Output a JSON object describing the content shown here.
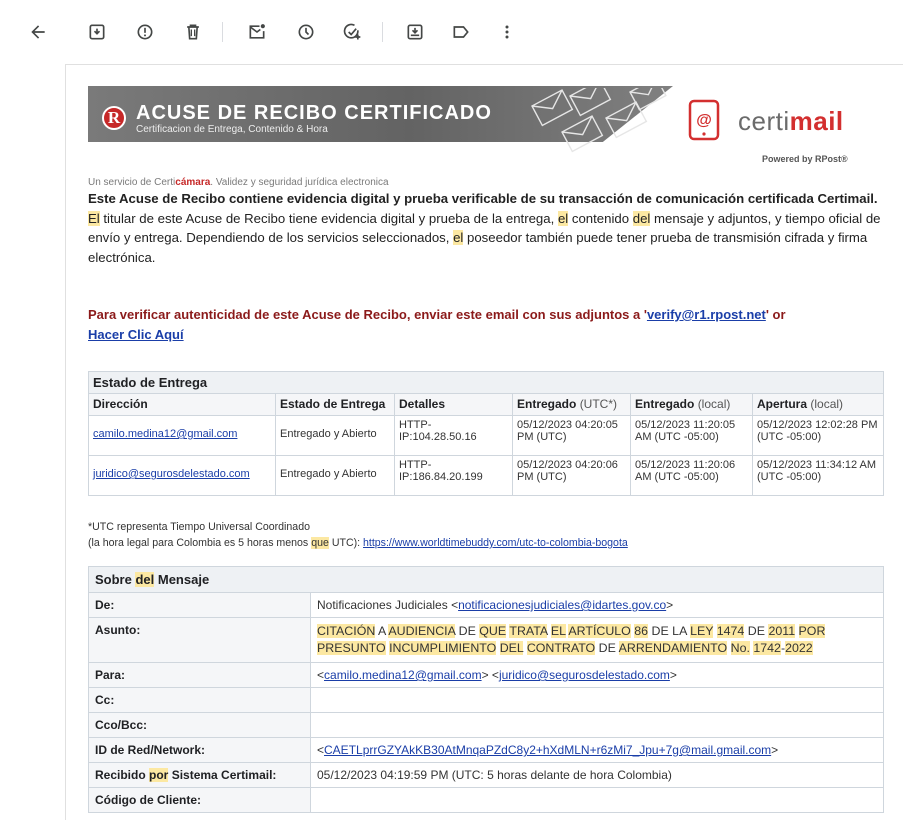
{
  "toolbar": {
    "back_icon": "arrow-left-icon",
    "icons": [
      "archive-icon",
      "report-spam-icon",
      "delete-icon",
      "mark-unread-icon",
      "snooze-icon",
      "add-task-icon",
      "move-to-icon",
      "label-icon",
      "more-vert-icon"
    ]
  },
  "banner": {
    "r_letter": "R",
    "title": "ACUSE DE RECIBO CERTIFICADO",
    "subtitle": "Certificacion de Entrega, Contenido & Hora",
    "service_prefix": "Un servicio de Certi",
    "service_brand": "cámara",
    "service_suffix": ". Validez y seguridad jurídica electronica",
    "logo_certi": "certi",
    "logo_mail": "mail",
    "powered": "Powered by RPost®"
  },
  "intro": {
    "heading": "Este Acuse de Recibo contiene evidencia digital y prueba verificable de su transacción de comunicación certificada Certimail.",
    "p_el1": "El",
    "p_part1": " titular de este Acuse de Recibo tiene evidencia digital y prueba de la entrega, ",
    "p_el2": "el",
    "p_part2": " contenido ",
    "p_del": "del",
    "p_part3": " mensaje y adjuntos, y tiempo oficial de envío y entrega. Dependiendo de los servicios seleccionados, ",
    "p_el3": "el",
    "p_part4": " poseedor también puede tener prueba de transmisión cifrada y firma electrónica."
  },
  "verify": {
    "prefix": "Para verificar autenticidad de este Acuse de Recibo, enviar este email con sus adjuntos a '",
    "email": "verify@r1.rpost.net",
    "mid": "' or",
    "click": "Hacer Clic Aquí"
  },
  "delivery": {
    "title": "Estado de Entrega",
    "headers": {
      "direccion": "Dirección",
      "estado": "Estado de Entrega",
      "detalles": "Detalles",
      "entregado_utc": "Entregado",
      "entregado_utc_tag": "(UTC*)",
      "entregado_local": "Entregado",
      "entregado_local_tag": "(local)",
      "apertura": "Apertura",
      "apertura_tag": "(local)"
    },
    "rows": [
      {
        "address": "camilo.medina12@gmail.com",
        "status": "Entregado y Abierto",
        "details": "HTTP-IP:104.28.50.16",
        "utc": "05/12/2023 04:20:05 PM (UTC)",
        "local": "05/12/2023 11:20:05 AM (UTC -05:00)",
        "opened": "05/12/2023 12:02:28 PM (UTC -05:00)"
      },
      {
        "address": "juridico@segurosdelestado.com",
        "status": "Entregado y Abierto",
        "details": "HTTP-IP:186.84.20.199",
        "utc": "05/12/2023 04:20:06 PM (UTC)",
        "local": "05/12/2023 11:20:06 AM (UTC -05:00)",
        "opened": "05/12/2023 11:34:12 AM (UTC -05:00)"
      }
    ]
  },
  "note": {
    "line1": "*UTC representa Tiempo Universal Coordinado",
    "line2_prefix": "(la hora legal para Colombia es 5 horas menos ",
    "line2_que": "que",
    "line2_mid": " UTC): ",
    "link": "https://www.worldtimebuddy.com/utc-to-colombia-bogota"
  },
  "message": {
    "title_prefix": "Sobre ",
    "title_del": "del",
    "title_suffix": " Mensaje",
    "de_label": "De:",
    "de_name": "Notificaciones Judiciales <",
    "de_email": "notificacionesjudiciales@idartes.gov.co",
    "de_close": ">",
    "asunto_label": "Asunto:",
    "asunto_words": [
      {
        "t": "CITACIÓN",
        "h": true
      },
      {
        "t": " A ",
        "h": false
      },
      {
        "t": "AUDIENCIA",
        "h": true
      },
      {
        "t": " DE ",
        "h": false
      },
      {
        "t": "QUE",
        "h": true
      },
      {
        "t": " ",
        "h": false
      },
      {
        "t": "TRATA",
        "h": true
      },
      {
        "t": " ",
        "h": false
      },
      {
        "t": "EL",
        "h": true
      },
      {
        "t": " ",
        "h": false
      },
      {
        "t": "ARTÍCULO",
        "h": true
      },
      {
        "t": " ",
        "h": false
      },
      {
        "t": "86",
        "h": true
      },
      {
        "t": " DE LA ",
        "h": false
      },
      {
        "t": "LEY",
        "h": true
      },
      {
        "t": " ",
        "h": false
      },
      {
        "t": "1474",
        "h": true
      },
      {
        "t": " DE ",
        "h": false
      },
      {
        "t": "2011",
        "h": true
      },
      {
        "t": " ",
        "h": false
      },
      {
        "t": "POR",
        "h": true
      },
      {
        "t": " ",
        "h": false
      },
      {
        "t": "PRESUNTO",
        "h": true
      },
      {
        "t": " ",
        "h": false
      },
      {
        "t": "INCUMPLIMIENTO",
        "h": true
      },
      {
        "t": " ",
        "h": false
      },
      {
        "t": "DEL",
        "h": true
      },
      {
        "t": " ",
        "h": false
      },
      {
        "t": "CONTRATO",
        "h": true
      },
      {
        "t": " DE ",
        "h": false
      },
      {
        "t": "ARRENDAMIENTO",
        "h": true
      },
      {
        "t": " ",
        "h": false
      },
      {
        "t": "No.",
        "h": true
      },
      {
        "t": " ",
        "h": false
      },
      {
        "t": "1742",
        "h": true
      },
      {
        "t": "-",
        "h": false
      },
      {
        "t": "2022",
        "h": true
      }
    ],
    "para_label": "Para:",
    "para_open1": "<",
    "para_email1": "camilo.medina12@gmail.com",
    "para_close1": "> <",
    "para_email2": "juridico@segurosdelestado.com",
    "para_close2": ">",
    "cc_label": "Cc:",
    "cco_label": "Cco/Bcc:",
    "id_label": "ID de Red/Network:",
    "id_open": "<",
    "id_value": "CAETLprrGZYAkKB30AtMnqaPZdC8y2+hXdMLN+r6zMi7_Jpu+7g@mail.gmail.com",
    "id_close": ">",
    "recibido_label_prefix": "Recibido ",
    "recibido_label_por": "por",
    "recibido_label_suffix": " Sistema Certimail:",
    "recibido_value": "05/12/2023 04:19:59 PM (UTC: 5 horas delante de hora Colombia)",
    "codigo_label": "Código de Cliente:"
  }
}
